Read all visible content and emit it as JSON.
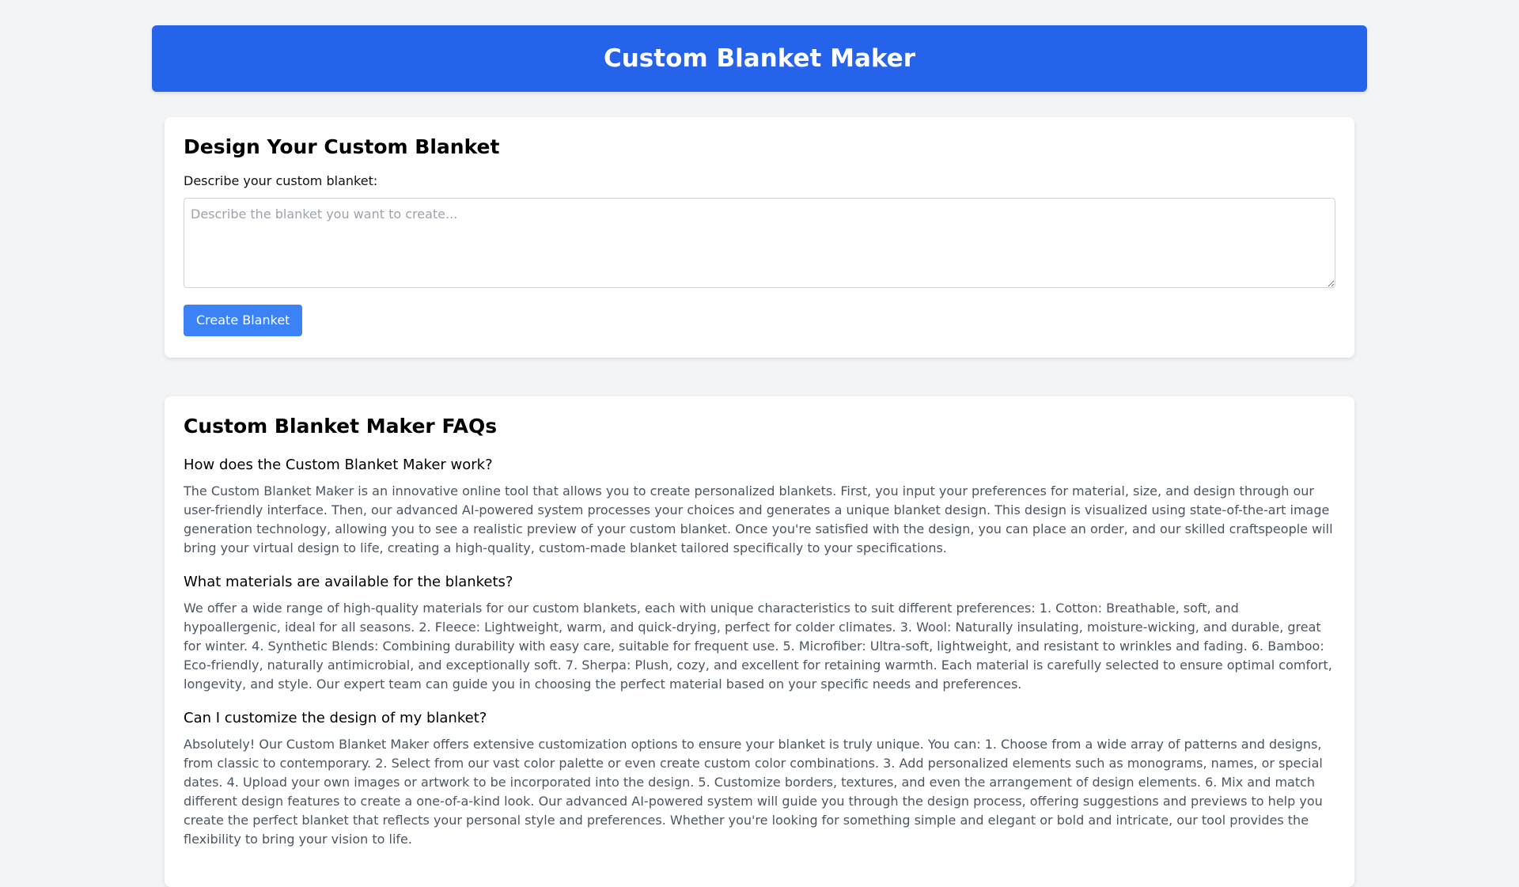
{
  "header": {
    "title": "Custom Blanket Maker"
  },
  "design": {
    "heading": "Design Your Custom Blanket",
    "label": "Describe your custom blanket:",
    "placeholder": "Describe the blanket you want to create...",
    "value": "",
    "button_label": "Create Blanket"
  },
  "faq": {
    "heading": "Custom Blanket Maker FAQs",
    "items": [
      {
        "question": "How does the Custom Blanket Maker work?",
        "answer": "The Custom Blanket Maker is an innovative online tool that allows you to create personalized blankets. First, you input your preferences for material, size, and design through our user-friendly interface. Then, our advanced AI-powered system processes your choices and generates a unique blanket design. This design is visualized using state-of-the-art image generation technology, allowing you to see a realistic preview of your custom blanket. Once you're satisfied with the design, you can place an order, and our skilled craftspeople will bring your virtual design to life, creating a high-quality, custom-made blanket tailored specifically to your specifications."
      },
      {
        "question": "What materials are available for the blankets?",
        "answer": "We offer a wide range of high-quality materials for our custom blankets, each with unique characteristics to suit different preferences: 1. Cotton: Breathable, soft, and hypoallergenic, ideal for all seasons. 2. Fleece: Lightweight, warm, and quick-drying, perfect for colder climates. 3. Wool: Naturally insulating, moisture-wicking, and durable, great for winter. 4. Synthetic Blends: Combining durability with easy care, suitable for frequent use. 5. Microfiber: Ultra-soft, lightweight, and resistant to wrinkles and fading. 6. Bamboo: Eco-friendly, naturally antimicrobial, and exceptionally soft. 7. Sherpa: Plush, cozy, and excellent for retaining warmth. Each material is carefully selected to ensure optimal comfort, longevity, and style. Our expert team can guide you in choosing the perfect material based on your specific needs and preferences."
      },
      {
        "question": "Can I customize the design of my blanket?",
        "answer": "Absolutely! Our Custom Blanket Maker offers extensive customization options to ensure your blanket is truly unique. You can: 1. Choose from a wide array of patterns and designs, from classic to contemporary. 2. Select from our vast color palette or even create custom color combinations. 3. Add personalized elements such as monograms, names, or special dates. 4. Upload your own images or artwork to be incorporated into the design. 5. Customize borders, textures, and even the arrangement of design elements. 6. Mix and match different design features to create a one-of-a-kind look. Our advanced AI-powered system will guide you through the design process, offering suggestions and previews to help you create the perfect blanket that reflects your personal style and preferences. Whether you're looking for something simple and elegant or bold and intricate, our tool provides the flexibility to bring your vision to life."
      }
    ]
  }
}
